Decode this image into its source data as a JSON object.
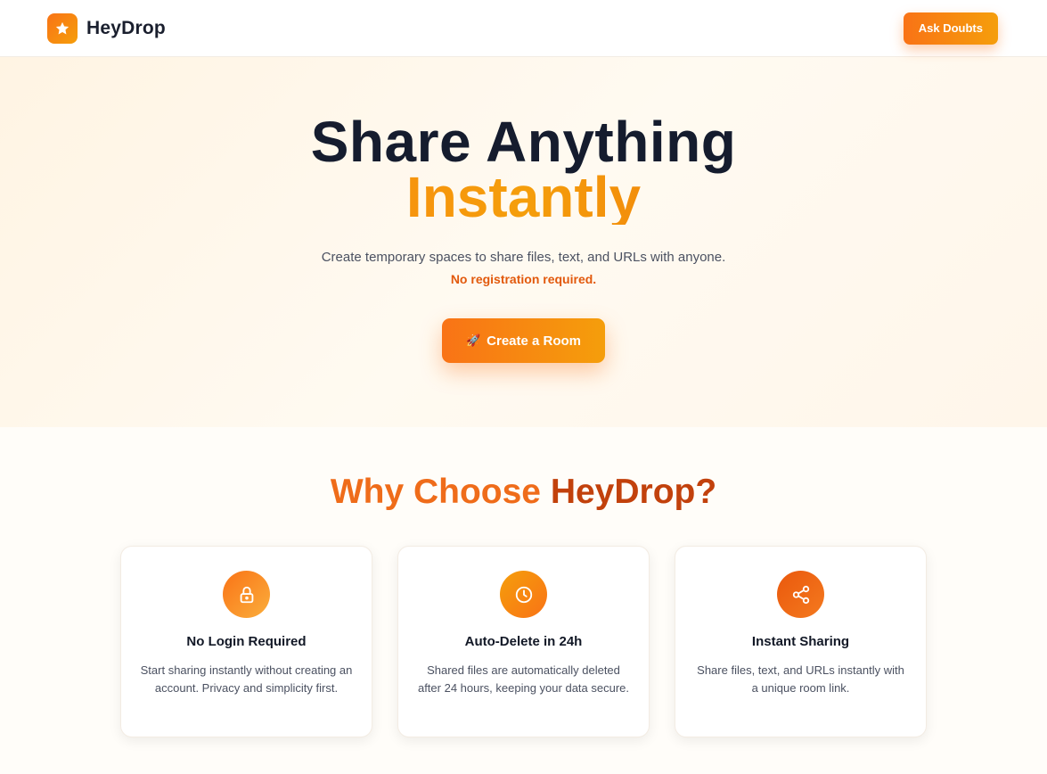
{
  "header": {
    "brand": "HeyDrop",
    "logo_icon": "star-icon",
    "ask_button": "Ask Doubts"
  },
  "hero": {
    "title_line1": "Share Anything",
    "title_line2": "Instantly",
    "subtitle": "Create temporary spaces to share files, text, and URLs with anyone.",
    "note": "No registration required.",
    "cta_icon": "🚀",
    "cta_label": "Create a Room"
  },
  "features": {
    "title_part1": "Why Choose",
    "title_part2": "HeyDrop?",
    "cards": [
      {
        "icon": "lock-icon",
        "title": "No Login Required",
        "description": "Start sharing instantly without creating an account. Privacy and simplicity first."
      },
      {
        "icon": "clock-icon",
        "title": "Auto-Delete in 24h",
        "description": "Shared files are automatically deleted after 24 hours, keeping your data secure."
      },
      {
        "icon": "share-icon",
        "title": "Instant Sharing",
        "description": "Share files, text, and URLs instantly with a unique room link."
      }
    ]
  },
  "colors": {
    "accent": "#f97316",
    "accent_secondary": "#f59e0b",
    "accent_dark": "#c2410c",
    "heading": "#151c2e"
  }
}
